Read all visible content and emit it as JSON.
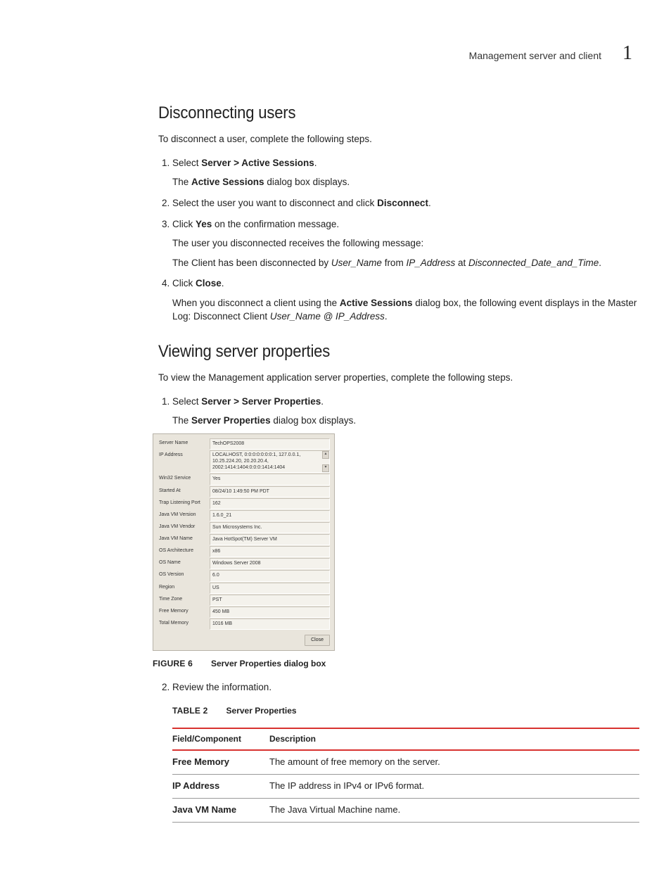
{
  "header": {
    "section": "Management server and client",
    "chapter": "1"
  },
  "s1": {
    "title": "Disconnecting users",
    "intro": "To disconnect a user, complete the following steps.",
    "step1_pre": "Select ",
    "step1_bold": "Server > Active Sessions",
    "step1_post": ".",
    "step1_sub_pre": "The ",
    "step1_sub_bold": "Active Sessions",
    "step1_sub_post": " dialog box displays.",
    "step2_pre": "Select the user you want to disconnect and click ",
    "step2_bold": "Disconnect",
    "step2_post": ".",
    "step3_pre": "Click ",
    "step3_bold": "Yes",
    "step3_post": " on the confirmation message.",
    "step3_sub1": "The user you disconnected receives the following message:",
    "step3_sub2_a": "The Client has been disconnected by ",
    "step3_sub2_i1": "User_Name",
    "step3_sub2_b": " from ",
    "step3_sub2_i2": "IP_Address",
    "step3_sub2_c": " at ",
    "step3_sub2_i3": "Disconnected_Date_and_Time",
    "step3_sub2_d": ".",
    "step4_pre": "Click ",
    "step4_bold": "Close",
    "step4_post": ".",
    "step4_sub_a": "When you disconnect a client using the ",
    "step4_sub_bold": "Active Sessions",
    "step4_sub_b": " dialog box, the following event displays in the Master Log: Disconnect Client ",
    "step4_sub_i": "User_Name @ IP_Address",
    "step4_sub_c": "."
  },
  "s2": {
    "title": "Viewing server properties",
    "intro": "To view the Management application server properties, complete the following steps.",
    "step1_pre": "Select ",
    "step1_bold": "Server > Server Properties",
    "step1_post": ".",
    "step1_sub_pre": "The ",
    "step1_sub_bold": "Server Properties",
    "step1_sub_post": " dialog box displays.",
    "step2": "Review the information."
  },
  "dialog": {
    "rows": [
      {
        "label": "Server Name",
        "value": "TechOPS2008"
      },
      {
        "label": "IP Address",
        "value": "LOCALHOST, 0:0:0:0:0:0:0:1, 127.0.0.1, 10.25.224.20, 20.20.20.4, 2002:1414:1404:0:0:0:1414:1404"
      },
      {
        "label": "Win32 Service",
        "value": "Yes"
      },
      {
        "label": "Started At",
        "value": "08/24/10 1:49:50 PM PDT"
      },
      {
        "label": "Trap Listening Port",
        "value": "162"
      },
      {
        "label": "Java VM Version",
        "value": "1.6.0_21"
      },
      {
        "label": "Java VM Vendor",
        "value": "Sun Microsystems Inc."
      },
      {
        "label": "Java VM Name",
        "value": "Java HotSpot(TM) Server VM"
      },
      {
        "label": "OS Architecture",
        "value": "x86"
      },
      {
        "label": "OS Name",
        "value": "Windows Server 2008"
      },
      {
        "label": "OS Version",
        "value": "6.0"
      },
      {
        "label": "Region",
        "value": "US"
      },
      {
        "label": "Time Zone",
        "value": "PST"
      },
      {
        "label": "Free Memory",
        "value": "450 MB"
      },
      {
        "label": "Total Memory",
        "value": "1016 MB"
      }
    ],
    "close": "Close",
    "scroll_up": "▴",
    "scroll_down": "▾"
  },
  "figure": {
    "label": "FIGURE 6",
    "title": "Server Properties dialog box"
  },
  "table": {
    "label": "TABLE 2",
    "title": "Server Properties",
    "head_field": "Field/Component",
    "head_desc": "Description",
    "rows": [
      {
        "f": "Free Memory",
        "d": "The amount of free memory on the server."
      },
      {
        "f": "IP Address",
        "d": "The IP address in IPv4 or IPv6 format."
      },
      {
        "f": "Java VM Name",
        "d": "The Java Virtual Machine name."
      }
    ]
  }
}
